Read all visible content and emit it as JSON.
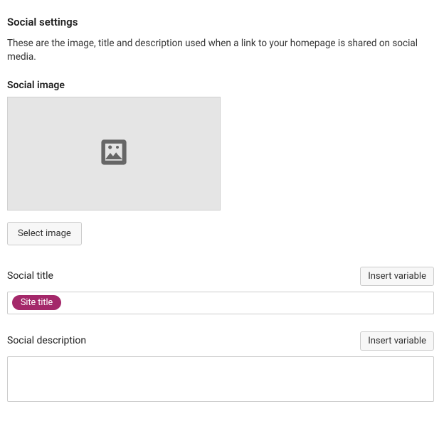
{
  "header": {
    "title": "Social settings",
    "description": "These are the image, title and description used when a link to your homepage is shared on social media."
  },
  "socialImage": {
    "label": "Social image",
    "button": "Select image"
  },
  "socialTitle": {
    "label": "Social title",
    "insertVariable": "Insert variable",
    "chip": "Site title",
    "value": ""
  },
  "socialDescription": {
    "label": "Social description",
    "insertVariable": "Insert variable",
    "value": ""
  },
  "colors": {
    "chipBg": "#a4286a"
  }
}
